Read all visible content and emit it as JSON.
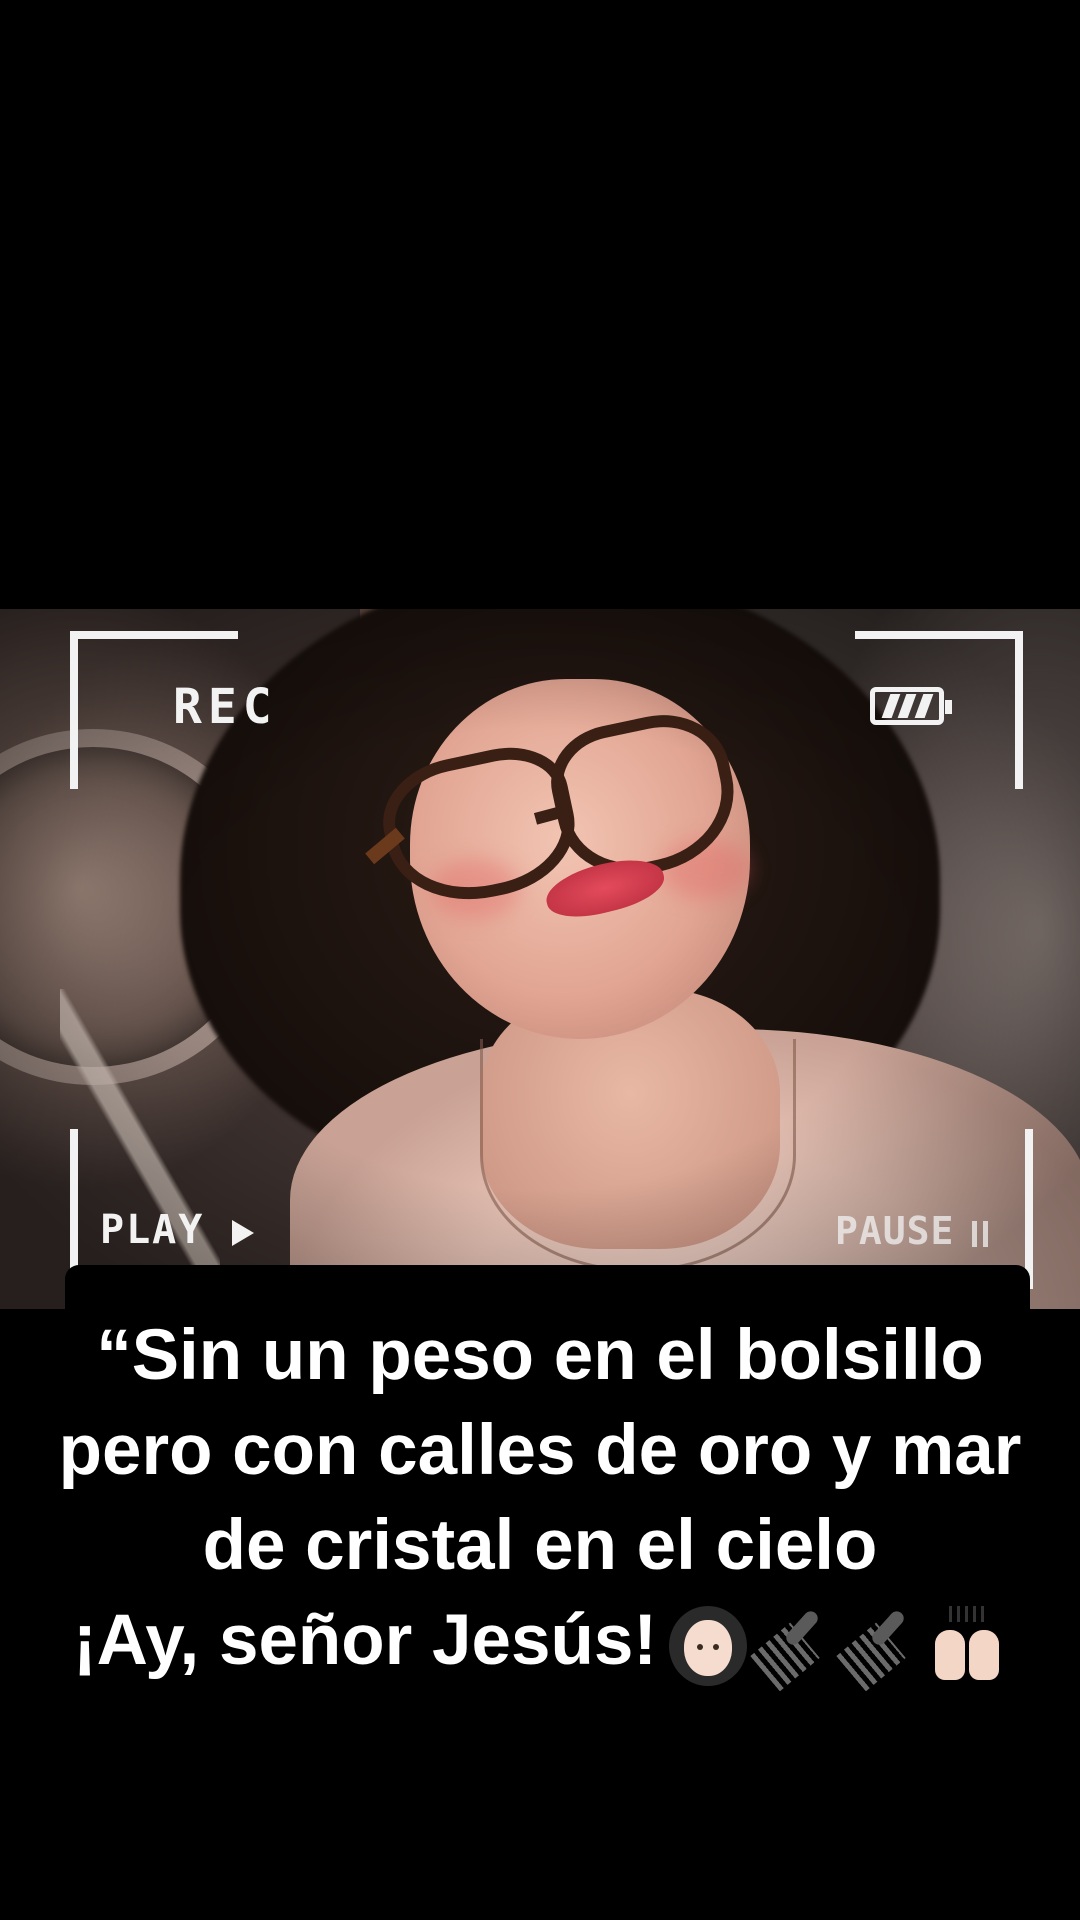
{
  "overlay": {
    "rec_label": "REC",
    "play_label": "PLAY",
    "pause_label": "PAUSE"
  },
  "caption": {
    "line1": "“Sin un peso en el bolsillo",
    "line2": "pero con calles de oro y mar",
    "line3": "de cristal en el cielo",
    "line4": "¡Ay, señor Jesús!",
    "emojis": [
      "woman-curly-hair-emoji",
      "hair-pick-emoji",
      "hair-pick-emoji",
      "raising-hands-emoji"
    ]
  },
  "colors": {
    "background": "#000000",
    "overlay_text": "#f2f2f2",
    "caption_text": "#ffffff"
  }
}
